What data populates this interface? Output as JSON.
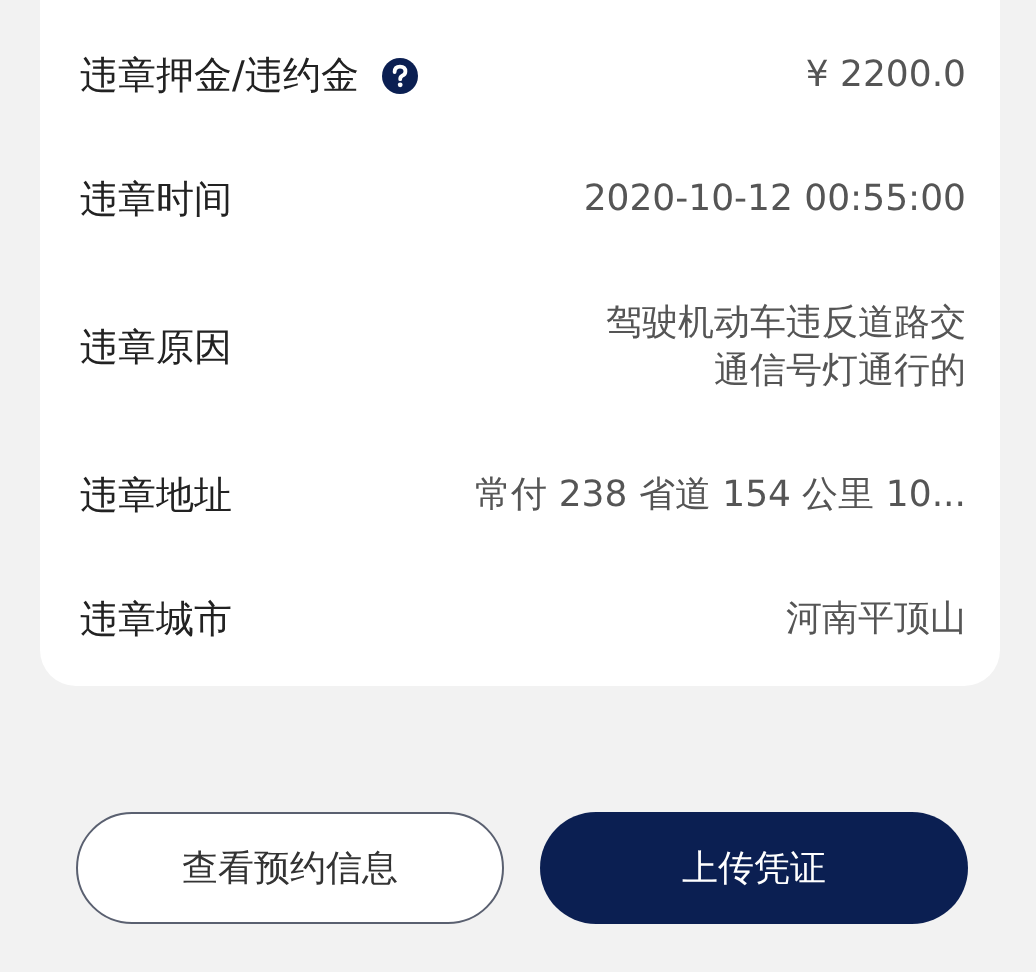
{
  "details": [
    {
      "label": "违章押金/违约金",
      "help": true,
      "value": "¥ 2200.0"
    },
    {
      "label": "违章时间",
      "help": false,
      "value": "2020-10-12 00:55:00"
    },
    {
      "label": "违章原因",
      "help": false,
      "value": "驾驶机动车违反道路交通信号灯通行的"
    },
    {
      "label": "违章地址",
      "help": false,
      "value": "常付 238 省道 154 公里 10..."
    },
    {
      "label": "违章城市",
      "help": false,
      "value": "河南平顶山"
    }
  ],
  "buttons": [
    {
      "label": "查看预约信息",
      "kind": "outline"
    },
    {
      "label": "上传凭证",
      "kind": "primary"
    }
  ]
}
